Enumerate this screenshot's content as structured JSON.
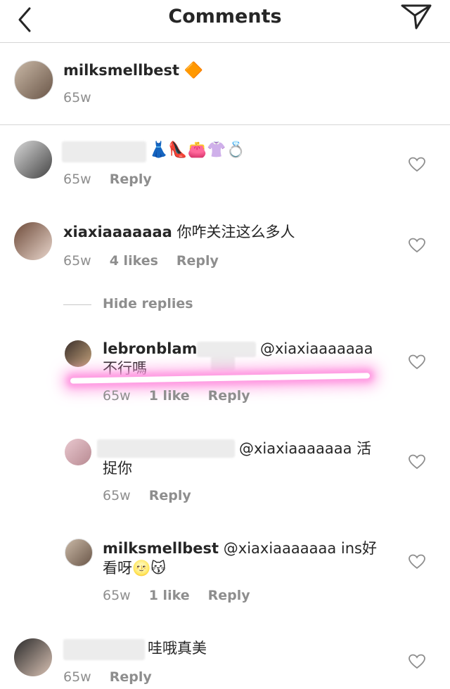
{
  "header": {
    "title": "Comments"
  },
  "post": {
    "username": "milksmellbest",
    "badge": "🔶",
    "time": "65w"
  },
  "comments": [
    {
      "text": "👗👠👛👚💍",
      "time": "65w",
      "reply_label": "Reply"
    },
    {
      "username": "xiaxiaaaaaaa",
      "text": "你咋关注这么多人",
      "time": "65w",
      "likes": "4 likes",
      "reply_label": "Reply"
    }
  ],
  "hide_replies": "Hide replies",
  "replies": [
    {
      "username": "lebronblam",
      "mention": "@xiaxiaaaaaaa",
      "text": "不行嗎",
      "time": "65w",
      "likes": "1 like",
      "reply_label": "Reply"
    },
    {
      "mention": "@xiaxiaaaaaaa 活",
      "text": "捉你",
      "time": "65w",
      "reply_label": "Reply"
    },
    {
      "username": "milksmellbest",
      "mention": "@xiaxiaaaaaaa ins好",
      "text": "看呀🌝😽",
      "time": "65w",
      "likes": "1 like",
      "reply_label": "Reply"
    }
  ],
  "last_comment": {
    "text": "哇哦真美",
    "time": "65w",
    "reply_label": "Reply"
  },
  "colors": {
    "highlight": "#ff9be2",
    "muted": "#8e8e8e",
    "text": "#262626"
  }
}
